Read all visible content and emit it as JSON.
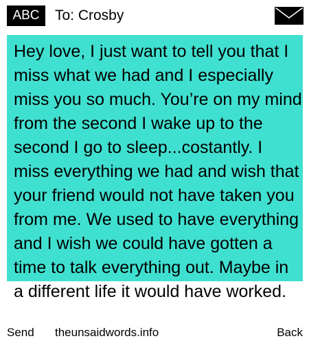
{
  "header": {
    "badge_label": "ABC",
    "recipient": "To: Crosby",
    "mail_icon": "envelope-icon"
  },
  "message": {
    "body": "Hey love, I just want to tell you that I miss what we had and I especially miss you so much. You’re on my mind from the second I wake up to the second I go to sleep...costantly. I miss everything we had and wish that your friend would not have taken you from me. We used to have everything and I wish we could have gotten a time to talk everything out. Maybe in a different life it would have worked.",
    "background_color": "#40e0d0"
  },
  "footer": {
    "send_label": "Send",
    "site_label": "theunsaidwords.info",
    "back_label": "Back"
  }
}
